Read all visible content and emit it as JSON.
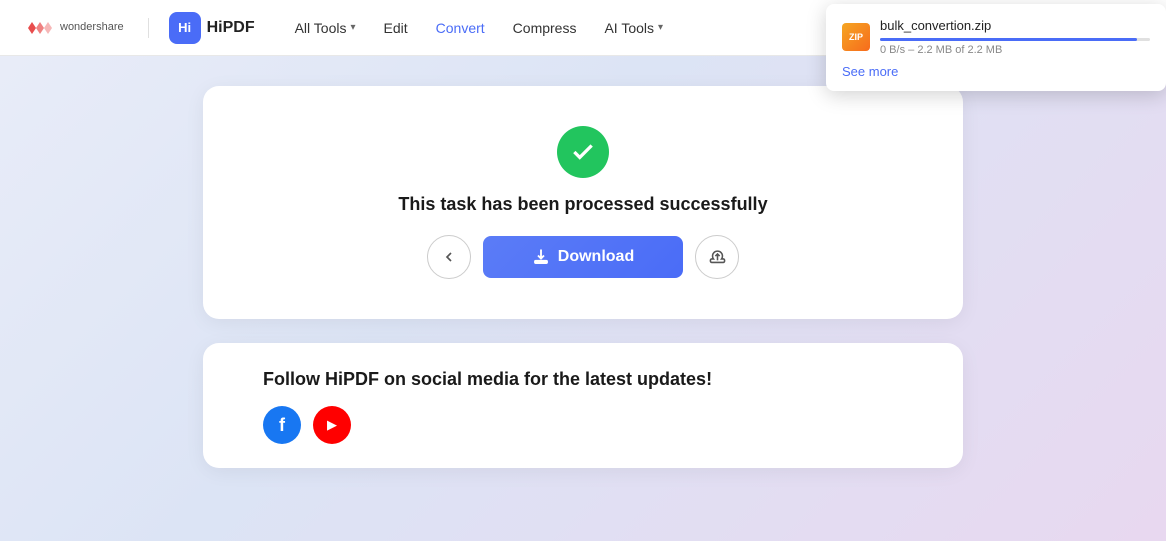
{
  "header": {
    "wondershare_label": "wondershare",
    "brand_label": "HiPDF",
    "nav": [
      {
        "label": "All Tools",
        "has_chevron": true,
        "active": false
      },
      {
        "label": "Edit",
        "has_chevron": false,
        "active": false
      },
      {
        "label": "Convert",
        "has_chevron": false,
        "active": true
      },
      {
        "label": "Compress",
        "has_chevron": false,
        "active": false
      },
      {
        "label": "AI Tools",
        "has_chevron": true,
        "active": false
      }
    ]
  },
  "main": {
    "success_text": "This task has been processed successfully",
    "download_label": "Download",
    "back_icon": "‹",
    "upload_icon": "↑"
  },
  "social": {
    "title": "Follow HiPDF on social media for the latest updates!",
    "facebook_letter": "f",
    "youtube_icon": "▶"
  },
  "download_popup": {
    "filename": "bulk_convertion.zip",
    "speed": "0 B/s",
    "progress_text": "2.2 MB of 2.2 MB",
    "see_more_label": "See more",
    "file_icon_text": "ZIP"
  }
}
